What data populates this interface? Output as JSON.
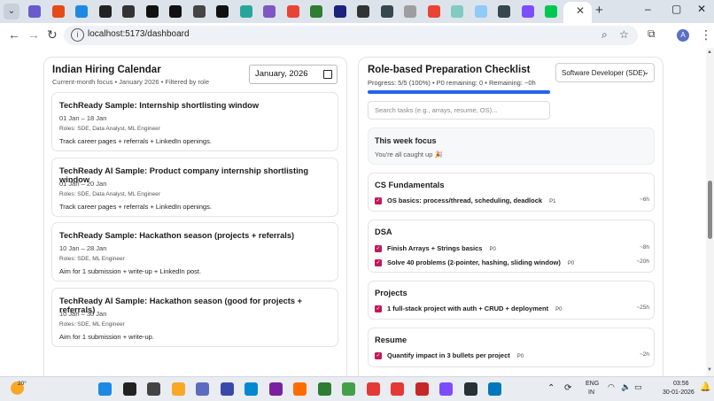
{
  "browser": {
    "tab_menu_icon": "chevron-down",
    "new_tab_label": "+",
    "window_buttons": [
      "–",
      "▢",
      "✕"
    ],
    "url": "localhost:5173/dashboard",
    "profile_initial": "A",
    "favicon_colors": [
      "#6a5acd",
      "#e64a19",
      "#1e88e5",
      "#222222",
      "#333333",
      "#111111",
      "#111111",
      "#444444",
      "#111111",
      "#26a69a",
      "#7e57c2",
      "#ea4335",
      "#2e7d32",
      "#1a237e",
      "#333333",
      "#37474f",
      "#9e9e9e",
      "#ea4335",
      "#80cbc4",
      "#90caf9",
      "#37474f",
      "#7c4dff",
      "#00c853"
    ]
  },
  "calendar": {
    "title": "Indian Hiring Calendar",
    "subtitle": "Current-month focus • January 2026 • Filtered by role",
    "month_value": "January, 2026",
    "events": [
      {
        "title": "TechReady Sample: Internship shortlisting window",
        "date": "01 Jan – 18 Jan",
        "roles": "Roles: SDE, Data Analyst, ML Engineer",
        "desc": "Track career pages + referrals + LinkedIn openings."
      },
      {
        "title": "TechReady AI Sample: Product company internship shortlisting window",
        "date": "01 Jan – 20 Jan",
        "roles": "Roles: SDE, Data Analyst, ML Engineer",
        "desc": "Track career pages + referrals + LinkedIn openings."
      },
      {
        "title": "TechReady Sample: Hackathon season (projects + referrals)",
        "date": "10 Jan – 28 Jan",
        "roles": "Roles: SDE, ML Engineer",
        "desc": "Aim for 1 submission + write-up + LinkedIn post."
      },
      {
        "title": "TechReady AI Sample: Hackathon season (good for projects + referrals)",
        "date": "10 Jan – 30 Jan",
        "roles": "Roles: SDE, ML Engineer",
        "desc": "Aim for 1 submission + write-up."
      }
    ]
  },
  "checklist": {
    "title": "Role-based Preparation Checklist",
    "role_selected": "Software Developer (SDE)",
    "progress_text": "Progress: 5/5 (100%) • P0 remaining: 0 • Remaining: ~0h",
    "progress_fraction": 1.0,
    "search_placeholder": "Search tasks (e.g., arrays, resume, OS)...",
    "focus": {
      "title": "This week focus",
      "text": "You're all caught up 🎉"
    },
    "sections": [
      {
        "title": "CS Fundamentals",
        "tasks": [
          {
            "label": "OS basics: process/thread, scheduling, deadlock",
            "priority": "P1",
            "time": "~6h"
          }
        ]
      },
      {
        "title": "DSA",
        "tasks": [
          {
            "label": "Finish Arrays + Strings basics",
            "priority": "P0",
            "time": "~8h"
          },
          {
            "label": "Solve 40 problems (2-pointer, hashing, sliding window)",
            "priority": "P0",
            "time": "~20h"
          }
        ]
      },
      {
        "title": "Projects",
        "tasks": [
          {
            "label": "1 full-stack project with auth + CRUD + deployment",
            "priority": "P0",
            "time": "~25h"
          }
        ]
      },
      {
        "title": "Resume",
        "tasks": [
          {
            "label": "Quantify impact in 3 bullets per project",
            "priority": "P0",
            "time": "~2h"
          }
        ]
      }
    ]
  },
  "taskbar": {
    "weather_temp": "20°",
    "lang_line1": "ENG",
    "lang_line2": "IN",
    "time": "03:56",
    "date": "30-01-2026",
    "app_colors": [
      "#1e88e5",
      "#222222",
      "#444444",
      "#f9a825",
      "#5c6bc0",
      "#3949ab",
      "#0288d1",
      "#7b1fa2",
      "#ff6d00",
      "#2e7d32",
      "#43a047",
      "#e53935",
      "#e53935",
      "#c62828",
      "#7c4dff",
      "#263238",
      "#0277bd"
    ]
  }
}
